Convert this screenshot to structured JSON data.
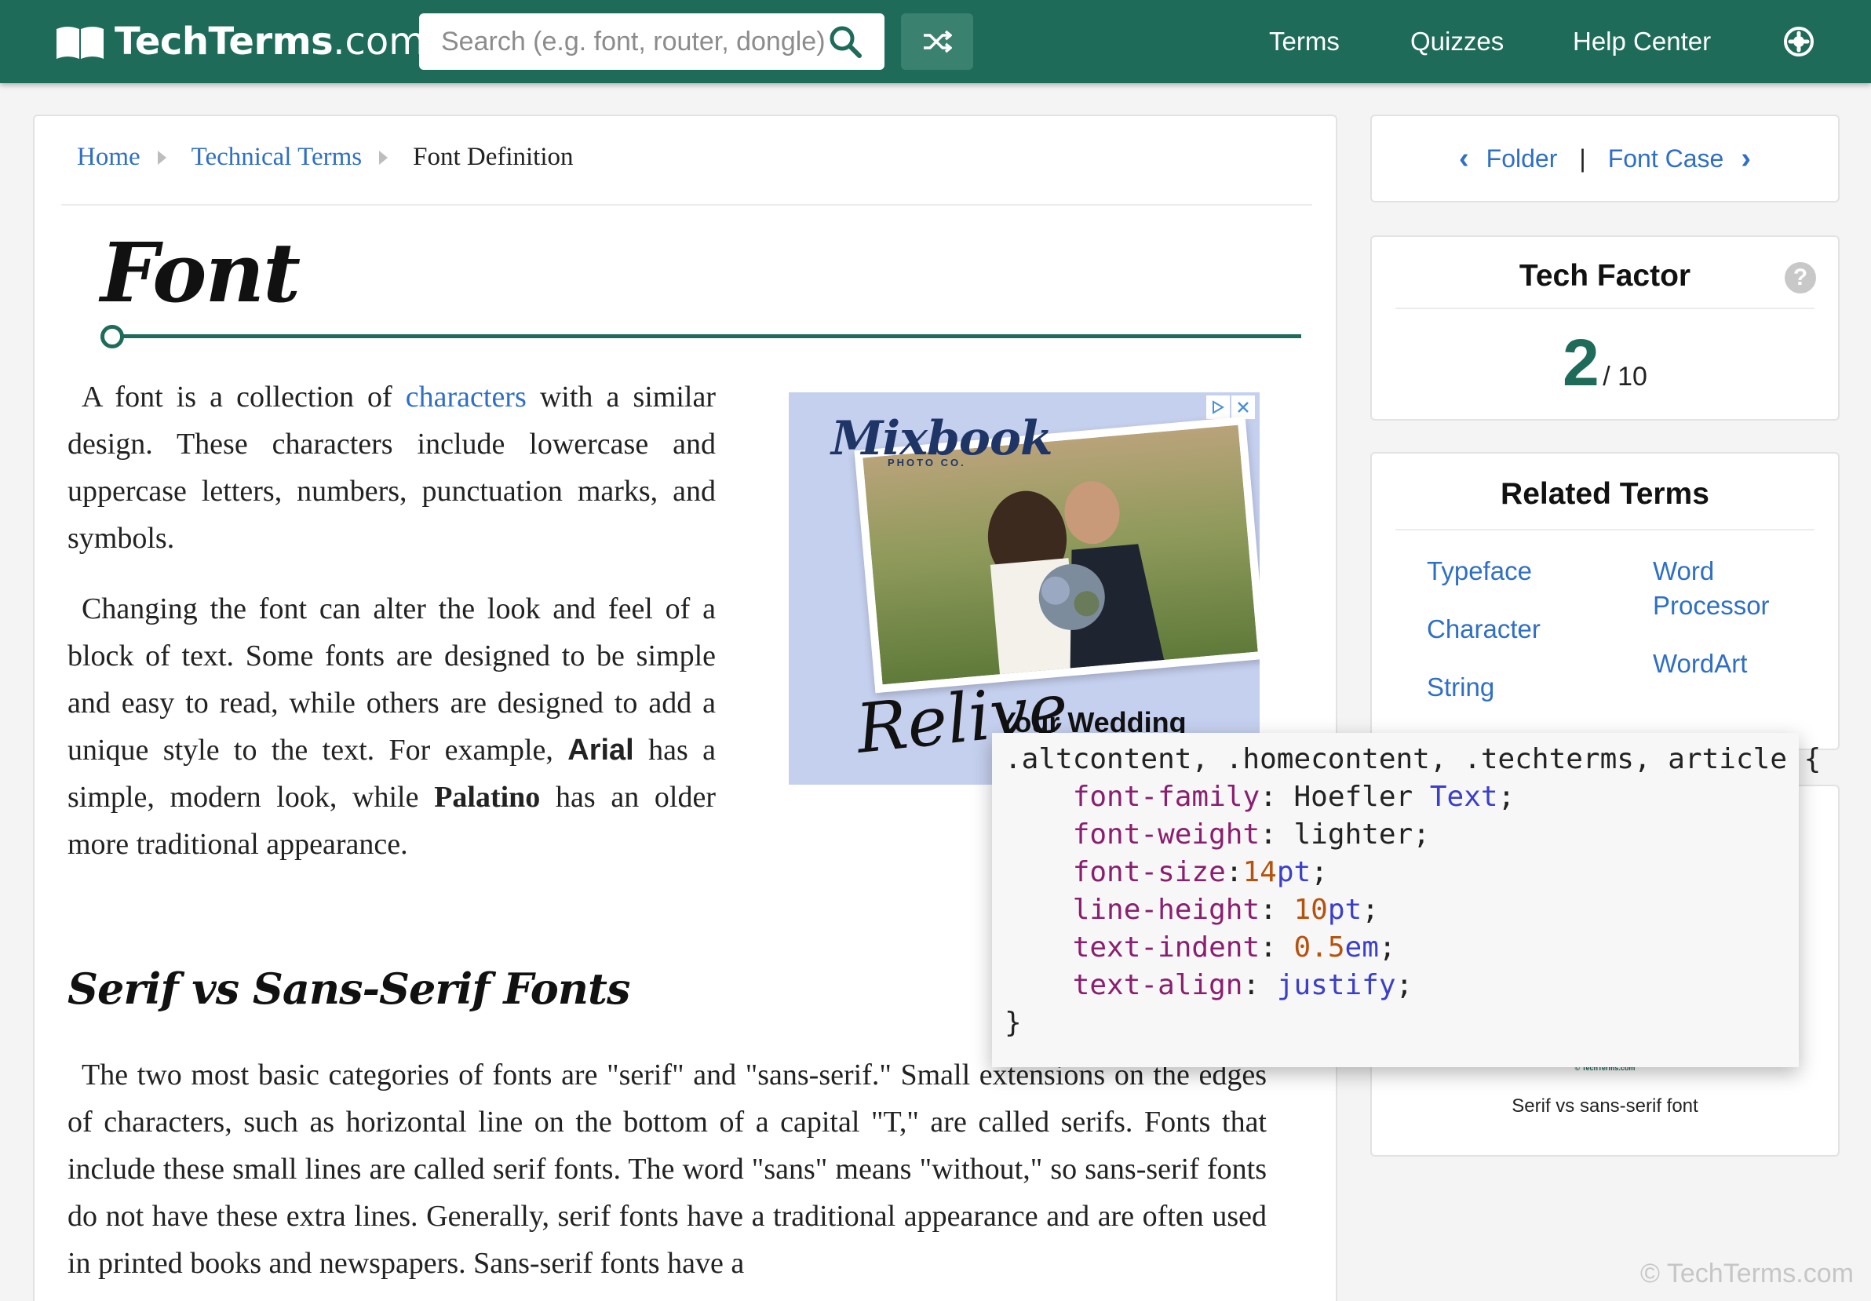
{
  "header": {
    "logo_brand": "TechTerms",
    "logo_tld": ".com",
    "search_placeholder": "Search (e.g. font, router, dongle)",
    "nav": [
      "Terms",
      "Quizzes",
      "Help Center"
    ],
    "colors": {
      "primary": "#1f6b5a",
      "link": "#2f6fc6"
    }
  },
  "breadcrumb": {
    "home": "Home",
    "category": "Technical Terms",
    "current": "Font Definition"
  },
  "article": {
    "title": "Font",
    "p1": {
      "before_link": "A font is a collection of ",
      "link": "characters",
      "after_link": " with a similar design. These characters include lowercase and uppercase letters, numbers, punctuation marks, and symbols."
    },
    "p2": {
      "a": "Changing the font can alter the look and feel of a block of text. Some fonts are designed to be simple and easy to read, while others are designed to add a unique style to the text. For example, ",
      "bold1": "Arial",
      "b": " has a simple, modern look, while ",
      "bold2": "Palatino",
      "c": " has an older more traditional appearance."
    },
    "h2": "Serif vs Sans-Serif Fonts",
    "p3": "The two most basic categories of fonts are \"serif\" and \"sans-serif.\" Small extensions on the edges of characters, such as horizontal line on the bottom of a capital \"T,\" are called serifs. Fonts that include these small lines are called serif fonts. The word \"sans\" means \"without,\" so sans-serif fonts do not have these extra lines. Generally, serif fonts have a traditional appearance and are often used in printed books and newspapers. Sans-serif fonts have a"
  },
  "ad": {
    "brand": "Mixbook",
    "brand_sub": "PHOTO CO.",
    "script": "Relive",
    "headline": "Your Wedding"
  },
  "pager": {
    "prev": "Folder",
    "sep": "|",
    "next": "Font Case"
  },
  "tech_factor": {
    "title": "Tech Factor",
    "value": "2",
    "scale": "/ 10",
    "help": "?"
  },
  "related": {
    "title": "Related Terms",
    "items": [
      "Typeface",
      "Character",
      "String",
      "Word Processor",
      "WordArt"
    ]
  },
  "image_card": {
    "tiny": "© TechTerms.com",
    "caption": "Serif vs sans-serif font"
  },
  "code_popup": {
    "selector": ".altcontent, .homecontent, .techterms, article {",
    "lines": [
      {
        "prop": "font-family",
        "value": "Hoefler ",
        "kw": "Text"
      },
      {
        "prop": "font-weight",
        "value": "lighter"
      },
      {
        "prop": "font-size",
        "num": "14",
        "unit": "pt"
      },
      {
        "prop": "line-height",
        "num": "10",
        "unit": "pt"
      },
      {
        "prop": "text-indent",
        "num": "0.5",
        "unit": "em"
      },
      {
        "prop": "text-align",
        "kw": "justify"
      }
    ],
    "close": "}"
  },
  "copyright": "© TechTerms.com"
}
